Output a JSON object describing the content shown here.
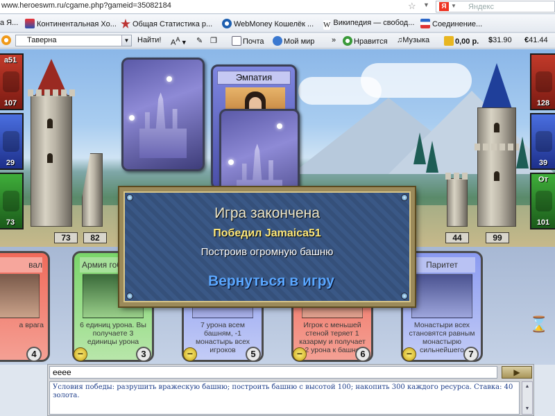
{
  "browser": {
    "url": "www.heroeswm.ru/cgame.php?gameid=35082184",
    "search_placeholder": "Яндекс",
    "search_logo": "Я"
  },
  "bookmarks": [
    {
      "label": "а Я...",
      "icon": "yandex-icon"
    },
    {
      "label": "Континентальная Хо...",
      "icon": "khl-icon"
    },
    {
      "label": "Общая Статистика р...",
      "icon": "star-icon"
    },
    {
      "label": "WebMoney Кошелёк ...",
      "icon": "webmoney-icon"
    },
    {
      "label": "Википедия — свобод...",
      "icon": "wikipedia-icon"
    },
    {
      "label": "Соединение...",
      "icon": "connection-icon"
    }
  ],
  "toolbar": {
    "location": "Таверна",
    "find_label": "Найти!",
    "mail": "Почта",
    "myworld": "Мой мир",
    "overflow": "»",
    "like": "Нравится",
    "music": "Музыка",
    "balance": "0,00 р.",
    "usd": "31.90",
    "eur": "41.44"
  },
  "game": {
    "left": {
      "name": "a51",
      "resources": [
        "107",
        "29",
        "73"
      ],
      "tower": "73",
      "wall": "82"
    },
    "right": {
      "resources": [
        "128",
        "39",
        "101"
      ],
      "name_top": "",
      "res_label_bottom": "От",
      "tower": "44",
      "wall": "99"
    },
    "played_card": {
      "title": "Эмпатия"
    },
    "hand": [
      {
        "title": "вал",
        "desc": "а врага",
        "cost": "4",
        "color": "red"
      },
      {
        "title": "Армия гоблинов",
        "desc": "6 единиц урона. Вы получаете 3 единицы урона",
        "cost": "3",
        "color": "green"
      },
      {
        "title": "",
        "desc": "7 урона всем башням, -1 монастырь всех игроков",
        "cost": "5",
        "color": "blue"
      },
      {
        "title": "",
        "desc": "Игрок с меньшей стеной теряет 1 казарму и получает 2 урона к башне",
        "cost": "6",
        "color": "red"
      },
      {
        "title": "Паритет",
        "desc": "Монастыри всех становятся равным монастырю сильнейшего",
        "cost": "7",
        "color": "blue"
      }
    ]
  },
  "dialog": {
    "title": "Игра закончена",
    "winner": "Победил Jamaica51",
    "reason": "Построив огромную башню",
    "button": "Вернуться в игру"
  },
  "chat": {
    "input_value": "eeee",
    "send_label": "▶",
    "log": "Условия победы: разрушить вражескую башню; построить башню с высотой 100; накопить 300 каждого ресурса. Ставка: 40 золота."
  }
}
